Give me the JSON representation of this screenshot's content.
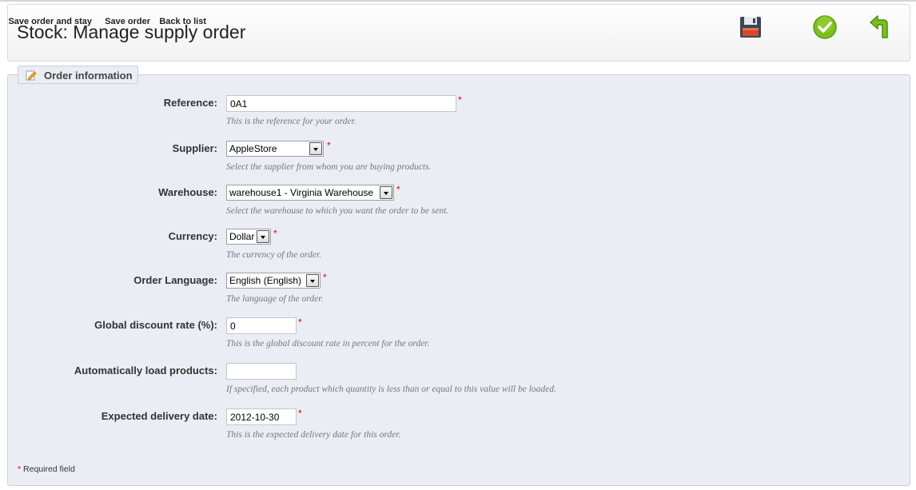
{
  "page": {
    "title": "Stock: Manage supply order"
  },
  "toolbar": {
    "save_stay_label": "Save order and stay",
    "save_label": "Save order",
    "back_label": "Back to list"
  },
  "fieldset": {
    "legend": "Order information"
  },
  "form": {
    "reference": {
      "label": "Reference:",
      "value": "0A1",
      "hint": "This is the reference for your order.",
      "required": "*"
    },
    "supplier": {
      "label": "Supplier:",
      "value": "AppleStore",
      "hint": "Select the supplier from whom you are buying products.",
      "required": "*"
    },
    "warehouse": {
      "label": "Warehouse:",
      "value": "warehouse1 - Virginia Warehouse",
      "hint": "Select the warehouse to which you want the order to be sent.",
      "required": "*"
    },
    "currency": {
      "label": "Currency:",
      "value": "Dollar",
      "hint": "The currency of the order.",
      "required": "*"
    },
    "language": {
      "label": "Order Language:",
      "value": "English (English)",
      "hint": "The language of the order.",
      "required": "*"
    },
    "discount": {
      "label": "Global discount rate (%):",
      "value": "0",
      "hint": "This is the global discount rate in percent for the order.",
      "required": "*"
    },
    "autoload": {
      "label": "Automatically load products:",
      "value": "",
      "hint": "If specified, each product which quantity is less than or equal to this value will be loaded."
    },
    "delivery": {
      "label": "Expected delivery date:",
      "value": "2012-10-30",
      "hint": "This is the expected delivery date for this order.",
      "required": "*"
    }
  },
  "footer": {
    "required_star": "*",
    "required_text": "Required field"
  },
  "colors": {
    "required": "#dd0000",
    "panel_bg": "#ebedf4",
    "save_green": "#7cc01e",
    "back_green": "#6aa313"
  }
}
